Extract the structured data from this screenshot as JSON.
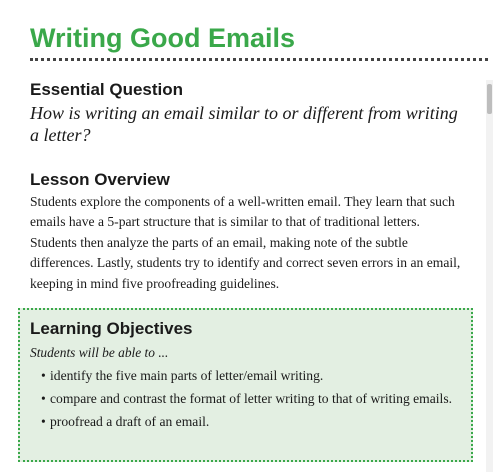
{
  "header": {
    "title": "Writing Good Emails"
  },
  "essential_question": {
    "heading": "Essential Question",
    "text": "How is writing an email similar to or different from writing a letter?"
  },
  "lesson_overview": {
    "heading": "Lesson Overview",
    "text": "Students explore the components of a well-written email. They learn that such emails have a 5-part structure that is similar to that of traditional letters. Students then analyze the parts of an email, making note of the subtle differences. Lastly, students try to identify and correct seven errors in an email, keeping in mind five proofreading guidelines."
  },
  "learning_objectives": {
    "heading": "Learning Objectives",
    "intro": "Students will be able to ...",
    "bullet": "•",
    "items": [
      "identify the five main parts of letter/email writing.",
      "compare and contrast the format of letter writing to that of writing emails.",
      "proofread a draft of an email."
    ]
  },
  "colors": {
    "title": "#3aa84a",
    "objectives_background": "#e3efe2",
    "objectives_border": "#3aa84a"
  }
}
